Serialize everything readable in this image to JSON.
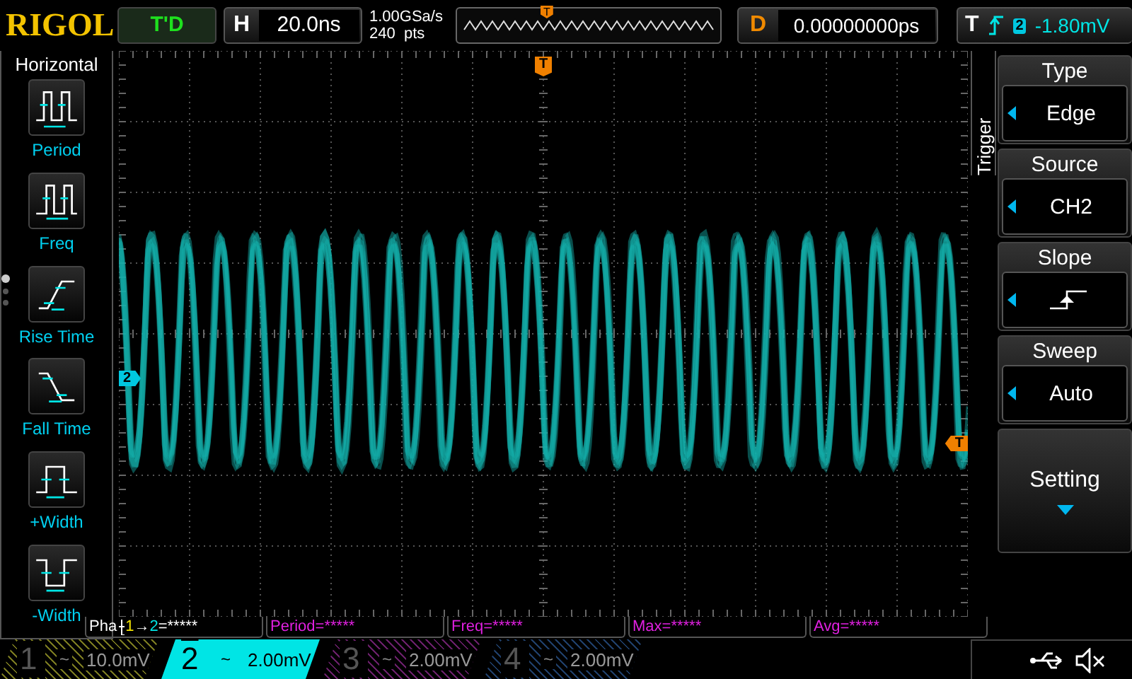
{
  "top_bar": {
    "brand": "RIGOL",
    "run_status": "T'D",
    "horizontal": {
      "label": "H",
      "timebase": "20.0ns"
    },
    "sample_rate": "1.00GSa/s",
    "memory_depth": "240  pts",
    "overview_marker": "T",
    "delay": {
      "label": "D",
      "value": "0.00000000ps"
    },
    "trigger": {
      "label": "T",
      "source": "2",
      "level": "-1.80mV"
    }
  },
  "left_menu": {
    "title": "Horizontal",
    "pages": [
      {
        "selected": true
      },
      {
        "selected": false
      },
      {
        "selected": false
      }
    ],
    "items": [
      {
        "kind": "period",
        "label": "Period"
      },
      {
        "kind": "freq",
        "label": "Freq"
      },
      {
        "kind": "rise",
        "label": "Rise Time"
      },
      {
        "kind": "fall",
        "label": "Fall Time"
      },
      {
        "kind": "pwidth",
        "label": "+Width"
      },
      {
        "kind": "nwidth",
        "label": "-Width"
      }
    ]
  },
  "screen": {
    "trigger_position_marker": "T",
    "channel_marker": "2",
    "trigger_level_marker": "T"
  },
  "right_menu": {
    "title": "Trigger",
    "items": [
      {
        "kind": "select",
        "label": "Type",
        "value": "Edge"
      },
      {
        "kind": "select",
        "label": "Source",
        "value": "CH2"
      },
      {
        "kind": "slope",
        "label": "Slope"
      },
      {
        "kind": "select",
        "label": "Sweep",
        "value": "Auto"
      },
      {
        "kind": "more",
        "label": "Setting"
      }
    ]
  },
  "measurements": [
    {
      "kind": "phase",
      "label": "Pha",
      "from": "1",
      "arrow": "→",
      "to": "2",
      "value": "=*****"
    },
    {
      "kind": "plain",
      "text": "Period=*****"
    },
    {
      "kind": "plain",
      "text": "Freq=*****"
    },
    {
      "kind": "plain",
      "text": "Max=*****"
    },
    {
      "kind": "plain",
      "text": "Avg=*****"
    }
  ],
  "channels": [
    {
      "number": "1",
      "coupling": "~",
      "scale": "10.0mV",
      "selected": false,
      "inverted": false,
      "color": "#7a7a20"
    },
    {
      "number": "2",
      "coupling": "~",
      "scale": "2.00mV",
      "selected": true,
      "inverted": true,
      "color": "#00e5e5"
    },
    {
      "number": "3",
      "coupling": "~",
      "scale": "2.00mV",
      "selected": false,
      "inverted": false,
      "color": "#6a1f6a"
    },
    {
      "number": "4",
      "coupling": "~",
      "scale": "2.00mV",
      "selected": false,
      "inverted": false,
      "color": "#1f3f6a"
    }
  ]
}
